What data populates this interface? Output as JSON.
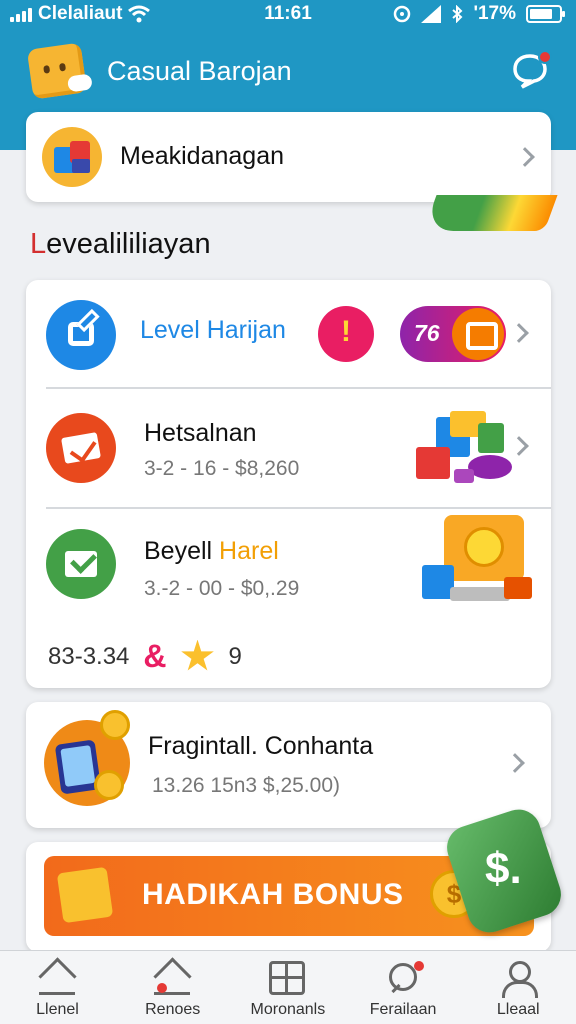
{
  "status_bar": {
    "carrier": "Clelaliaut",
    "time": "11:61",
    "battery": "'17%"
  },
  "header": {
    "title": "Casual Barojan"
  },
  "featured": {
    "label": "Meakidanagan"
  },
  "section": {
    "title_first": "L",
    "title_rest": "evealililiayan"
  },
  "rows": [
    {
      "title": "Level Harijan",
      "badge_number": "76"
    },
    {
      "title": "Hetsalnan",
      "subtitle": "3-2 - 16 - $8,260"
    },
    {
      "title_part1": "Beyell ",
      "title_part2": "Harel",
      "subtitle": "3.-2 - 00 - $0,.29"
    }
  ],
  "stats": {
    "value": "83-3.34",
    "amp": "&",
    "count": "9"
  },
  "fragment": {
    "title": "Fragintall. Conhanta",
    "subtitle": "13.26 15n3  $,25.00)"
  },
  "bonus": {
    "label": "HADIKAH BONUS",
    "coin_symbol": "$",
    "badge_text": "$."
  },
  "bottom_nav": [
    {
      "label": "Llenel",
      "icon": "home-icon"
    },
    {
      "label": "Renoes",
      "icon": "house-alert-icon"
    },
    {
      "label": "Moronanls",
      "icon": "grid-icon"
    },
    {
      "label": "Ferailaan",
      "icon": "search-icon"
    },
    {
      "label": "Lleaal",
      "icon": "user-icon"
    }
  ],
  "colors": {
    "header_bg": "#1f97c4",
    "accent_blue": "#1e88e5",
    "bonus_orange": "#f26a1b",
    "green": "#43a047",
    "pink": "#e91e63"
  }
}
